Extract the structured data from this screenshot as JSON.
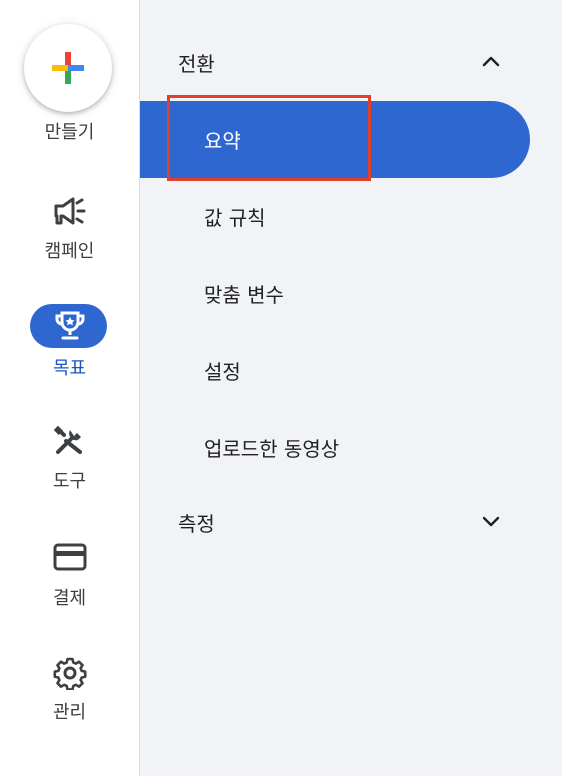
{
  "create": {
    "label": "만들기"
  },
  "rail": {
    "items": [
      {
        "label": "캠페인",
        "icon": "megaphone-icon"
      },
      {
        "label": "목표",
        "icon": "trophy-icon",
        "active": true
      },
      {
        "label": "도구",
        "icon": "tools-icon"
      },
      {
        "label": "결제",
        "icon": "credit-card-icon"
      },
      {
        "label": "관리",
        "icon": "gear-icon"
      }
    ]
  },
  "menu": {
    "sections": [
      {
        "title": "전환",
        "expanded": true,
        "items": [
          {
            "label": "요약",
            "selected": true
          },
          {
            "label": "값 규칙"
          },
          {
            "label": "맞춤 변수"
          },
          {
            "label": "설정"
          },
          {
            "label": "업로드한 동영상"
          }
        ]
      },
      {
        "title": "측정",
        "expanded": false,
        "items": []
      }
    ]
  },
  "colors": {
    "accent": "#2f67d0",
    "highlight": "#e0402b",
    "menu_bg": "#f1f3f6"
  }
}
